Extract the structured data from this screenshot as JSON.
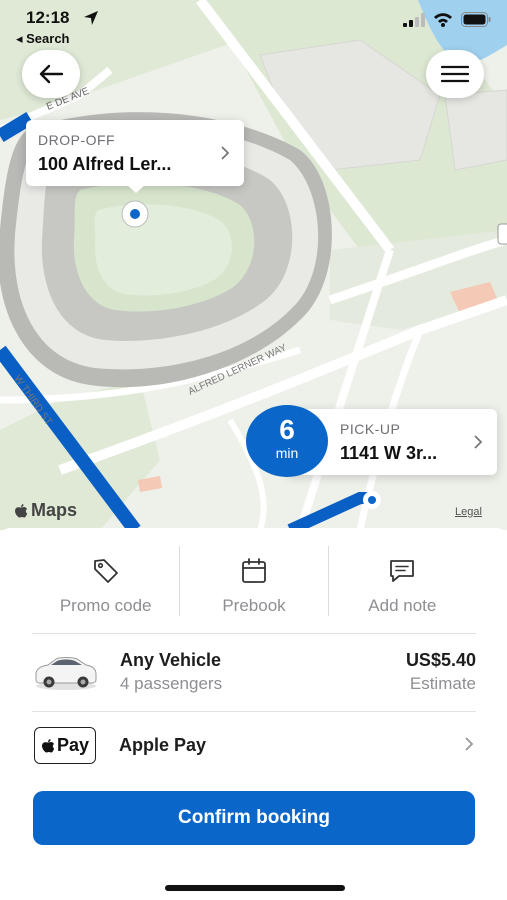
{
  "status_bar": {
    "time": "12:18",
    "back_app": "◂ Search"
  },
  "map": {
    "street_labels": [
      "E DE AVE",
      "ALFRED LERNER WAY",
      "W THIRD ST"
    ],
    "attribution": "Maps",
    "legal": "Legal"
  },
  "dropoff": {
    "caption": "DROP-OFF",
    "address": "100 Alfred Ler..."
  },
  "pickup": {
    "caption": "PICK-UP",
    "address": "1141 W 3r...",
    "eta_value": "6",
    "eta_unit": "min"
  },
  "actions": [
    {
      "label": "Promo code",
      "icon": "tag-icon"
    },
    {
      "label": "Prebook",
      "icon": "calendar-icon"
    },
    {
      "label": "Add note",
      "icon": "note-icon"
    }
  ],
  "vehicle": {
    "name": "Any Vehicle",
    "capacity": "4 passengers",
    "price": "US$5.40",
    "price_note": "Estimate"
  },
  "payment": {
    "badge": "Pay",
    "method": "Apple Pay"
  },
  "confirm_label": "Confirm booking",
  "colors": {
    "accent": "#0a66c9",
    "route": "#0a5fc4"
  }
}
